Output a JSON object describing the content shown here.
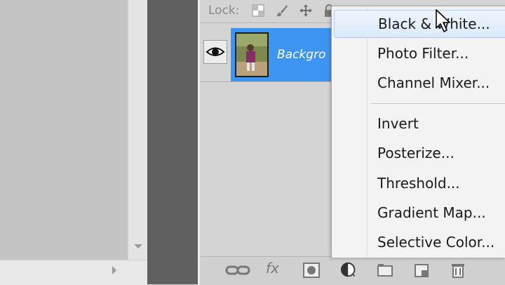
{
  "layers_panel": {
    "lock_label": "Lock:",
    "lock_icons": [
      "lock-transparent-icon",
      "lock-paint-icon",
      "lock-move-icon",
      "lock-all-icon"
    ],
    "layer": {
      "name": "Backgro",
      "visibility_icon": "eye-icon"
    },
    "bottom_icons": [
      "link-layers-icon",
      "fx-icon",
      "add-mask-icon",
      "adjustment-layer-icon",
      "new-group-icon",
      "new-layer-icon",
      "delete-layer-icon"
    ],
    "bottom_fx_label": "fx"
  },
  "adjustment_menu": {
    "items": [
      {
        "label": "Black & White..."
      },
      {
        "label": "Photo Filter..."
      },
      {
        "label": "Channel Mixer..."
      },
      {
        "label": "Invert"
      },
      {
        "label": "Posterize..."
      },
      {
        "label": "Threshold..."
      },
      {
        "label": "Gradient Map..."
      },
      {
        "label": "Selective Color..."
      }
    ],
    "hovered": "Black & White..."
  },
  "colors": {
    "selection": "#3d95f0",
    "panel": "#d4d4d4",
    "menu_bg": "#f3f3f3",
    "dark_divider": "#5f5f5f"
  }
}
